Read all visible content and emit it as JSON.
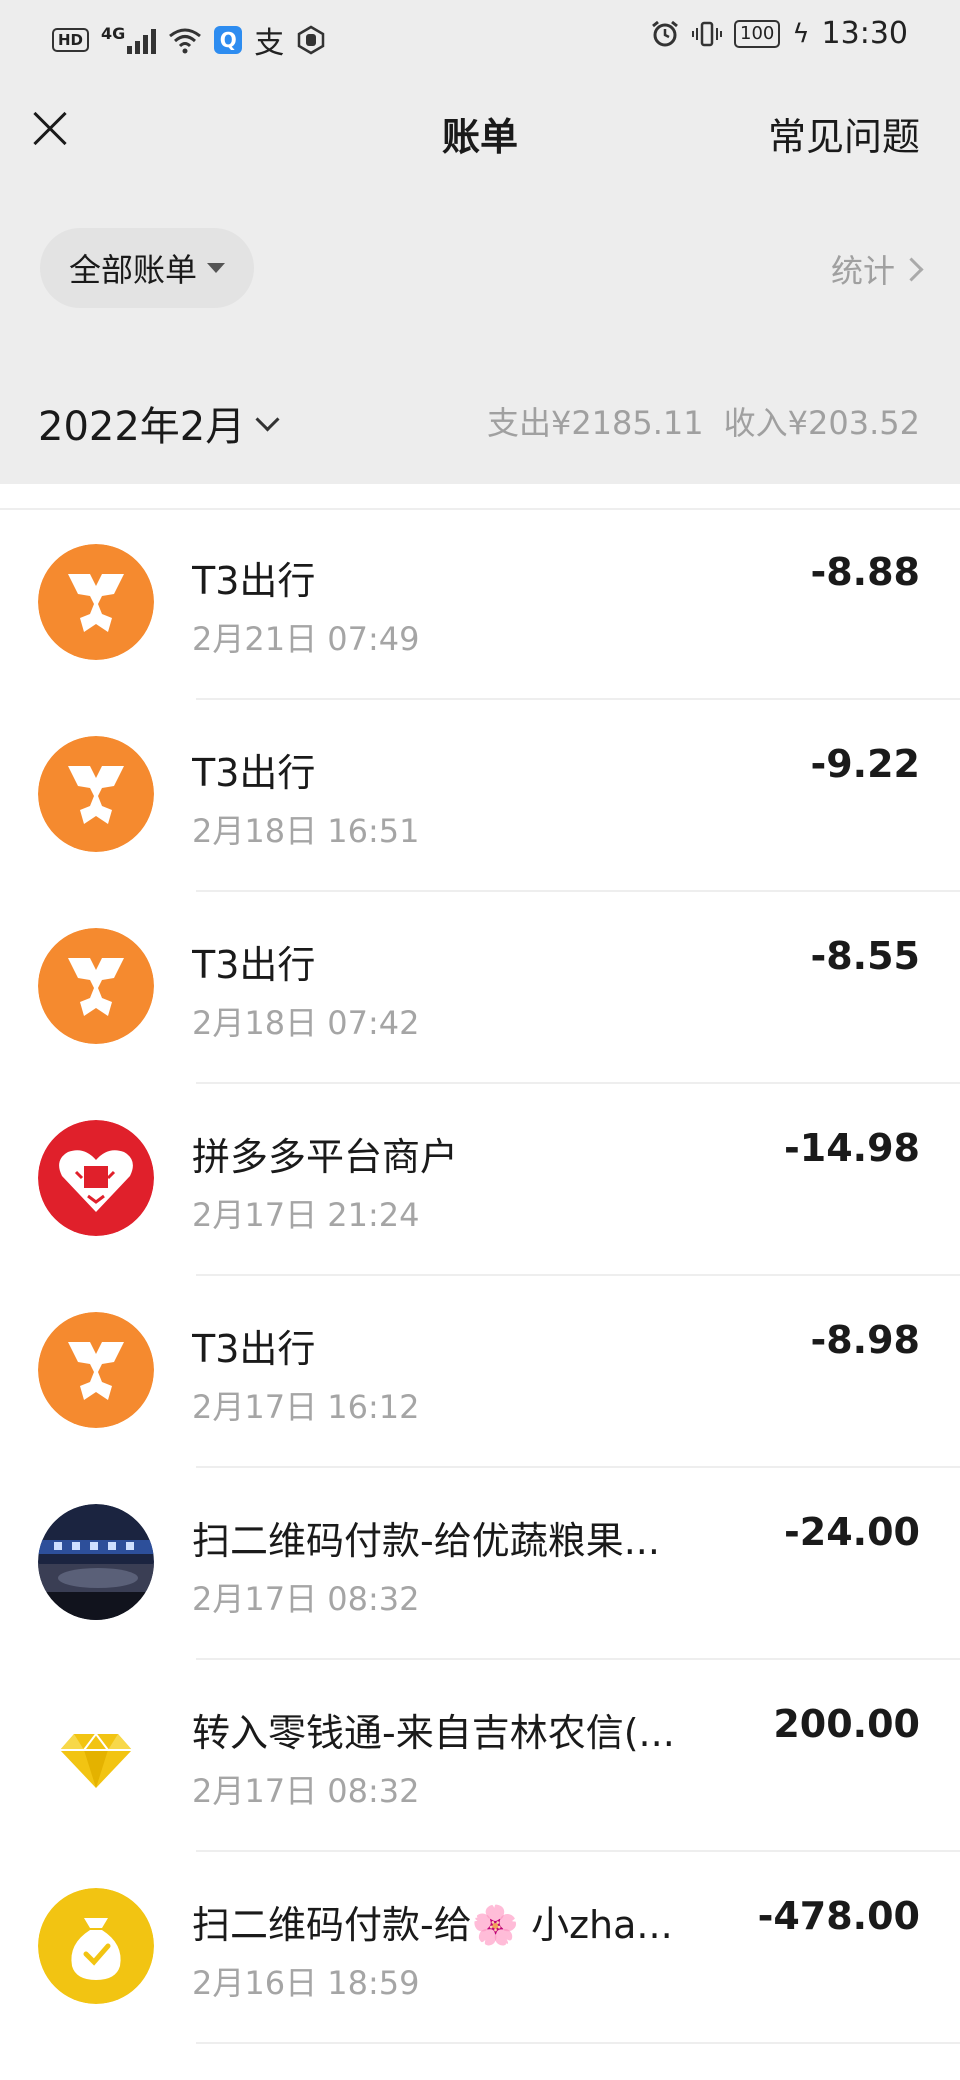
{
  "status_bar": {
    "hd": "HD",
    "network": "4G",
    "alipay_glyph": "支",
    "battery": "100",
    "time": "13:30",
    "icons": [
      "signal-icon",
      "wifi-icon",
      "search-app-icon",
      "alipay-icon",
      "hand-icon",
      "alarm-icon",
      "vibrate-icon",
      "battery-icon",
      "charging-icon"
    ]
  },
  "nav": {
    "title": "账单",
    "faq": "常见问题"
  },
  "filter": {
    "label": "全部账单",
    "stats": "统计"
  },
  "month": {
    "label": "2022年2月",
    "expense": "支出¥2185.11",
    "income": "收入¥203.52"
  },
  "colors": {
    "header_bg": "#ededed",
    "t3_orange": "#f58a2f",
    "pdd_red": "#e0202b",
    "gold": "#f2c412"
  },
  "transactions": [
    {
      "name": "T3出行",
      "time": "2月21日 07:49",
      "amount": "-8.88",
      "icon": "t3-icon"
    },
    {
      "name": "T3出行",
      "time": "2月18日 16:51",
      "amount": "-9.22",
      "icon": "t3-icon"
    },
    {
      "name": "T3出行",
      "time": "2月18日 07:42",
      "amount": "-8.55",
      "icon": "t3-icon"
    },
    {
      "name": "拼多多平台商户",
      "time": "2月17日 21:24",
      "amount": "-14.98",
      "icon": "pinduoduo-icon"
    },
    {
      "name": "T3出行",
      "time": "2月17日 16:12",
      "amount": "-8.98",
      "icon": "t3-icon"
    },
    {
      "name": "扫二维码付款-给优蔬粮果...",
      "time": "2月17日 08:32",
      "amount": "-24.00",
      "icon": "store-photo-avatar"
    },
    {
      "name": "转入零钱通-来自吉林农信(...",
      "time": "2月17日 08:32",
      "amount": "200.00",
      "icon": "diamond-icon"
    },
    {
      "name": "扫二维码付款-给🌸 小zha...",
      "time": "2月16日 18:59",
      "amount": "-478.00",
      "icon": "money-bag-icon"
    }
  ]
}
